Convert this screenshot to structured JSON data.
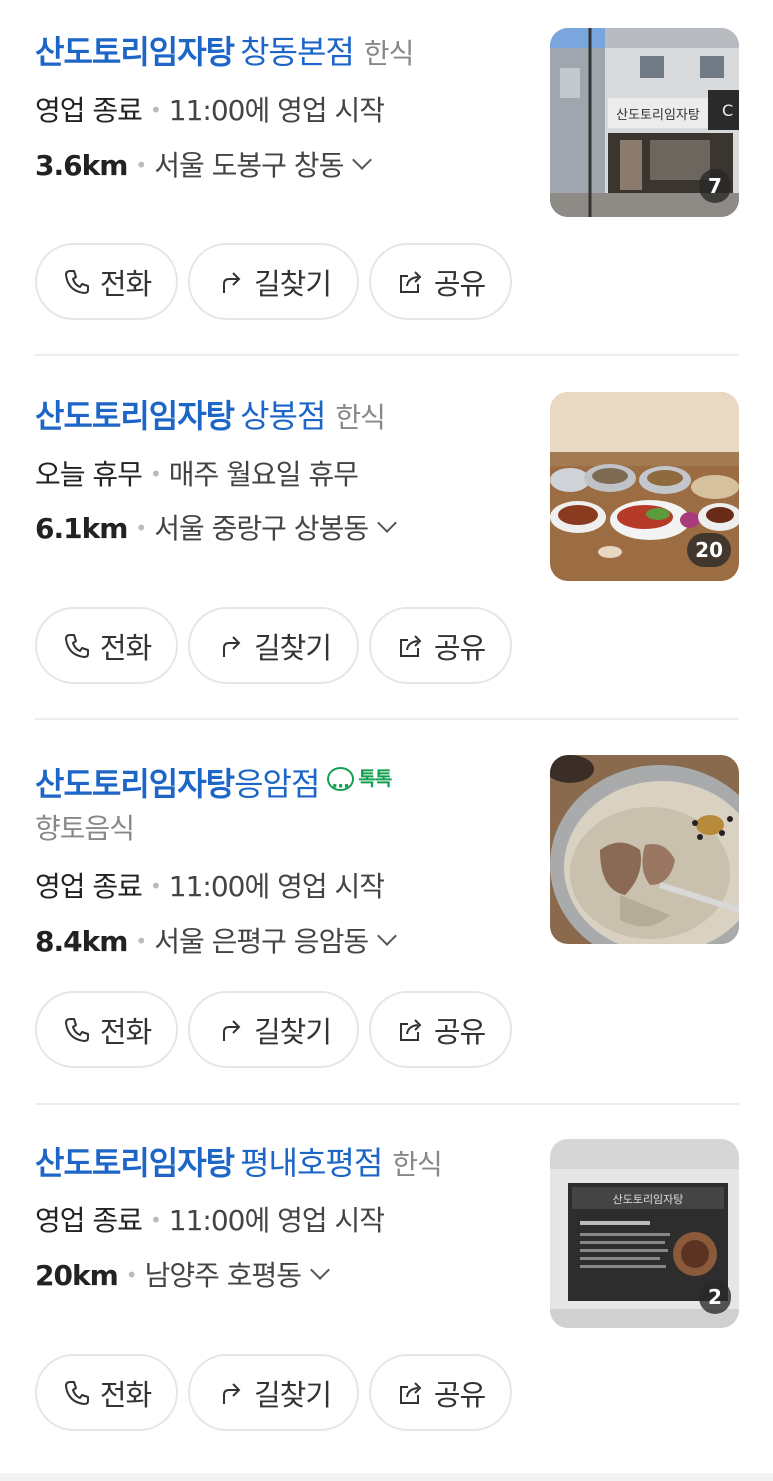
{
  "results": [
    {
      "brand": "산도토리임자탕",
      "branch": "창동본점",
      "category": "한식",
      "status": "영업 종료",
      "status_detail": "11:00에 영업 시작",
      "distance": "3.6km",
      "address": "서울 도봉구 창동",
      "photo_count": "7",
      "actions": {
        "call": "전화",
        "route": "길찾기",
        "share": "공유"
      }
    },
    {
      "brand": "산도토리임자탕",
      "branch": "상봉점",
      "category": "한식",
      "status": "오늘 휴무",
      "status_detail": "매주 월요일 휴무",
      "distance": "6.1km",
      "address": "서울 중랑구 상봉동",
      "photo_count": "20",
      "actions": {
        "call": "전화",
        "route": "길찾기",
        "share": "공유"
      }
    },
    {
      "brand": "산도토리임자탕",
      "branch": "응암점",
      "talk_label": "톡톡",
      "category": "향토음식",
      "status": "영업 종료",
      "status_detail": "11:00에 영업 시작",
      "distance": "8.4km",
      "address": "서울 은평구 응암동",
      "actions": {
        "call": "전화",
        "route": "길찾기",
        "share": "공유"
      }
    },
    {
      "brand": "산도토리임자탕",
      "branch": "평내호평점",
      "category": "한식",
      "status": "영업 종료",
      "status_detail": "11:00에 영업 시작",
      "distance": "20km",
      "address": "남양주 호평동",
      "photo_count": "2",
      "actions": {
        "call": "전화",
        "route": "길찾기",
        "share": "공유"
      }
    }
  ],
  "colors": {
    "brand_blue": "#1d66c7",
    "talk_green": "#14a050",
    "muted_gray": "#888888"
  },
  "icons": [
    "phone-icon",
    "route-arrow-icon",
    "share-icon",
    "chevron-down-icon",
    "talktalk-icon"
  ]
}
